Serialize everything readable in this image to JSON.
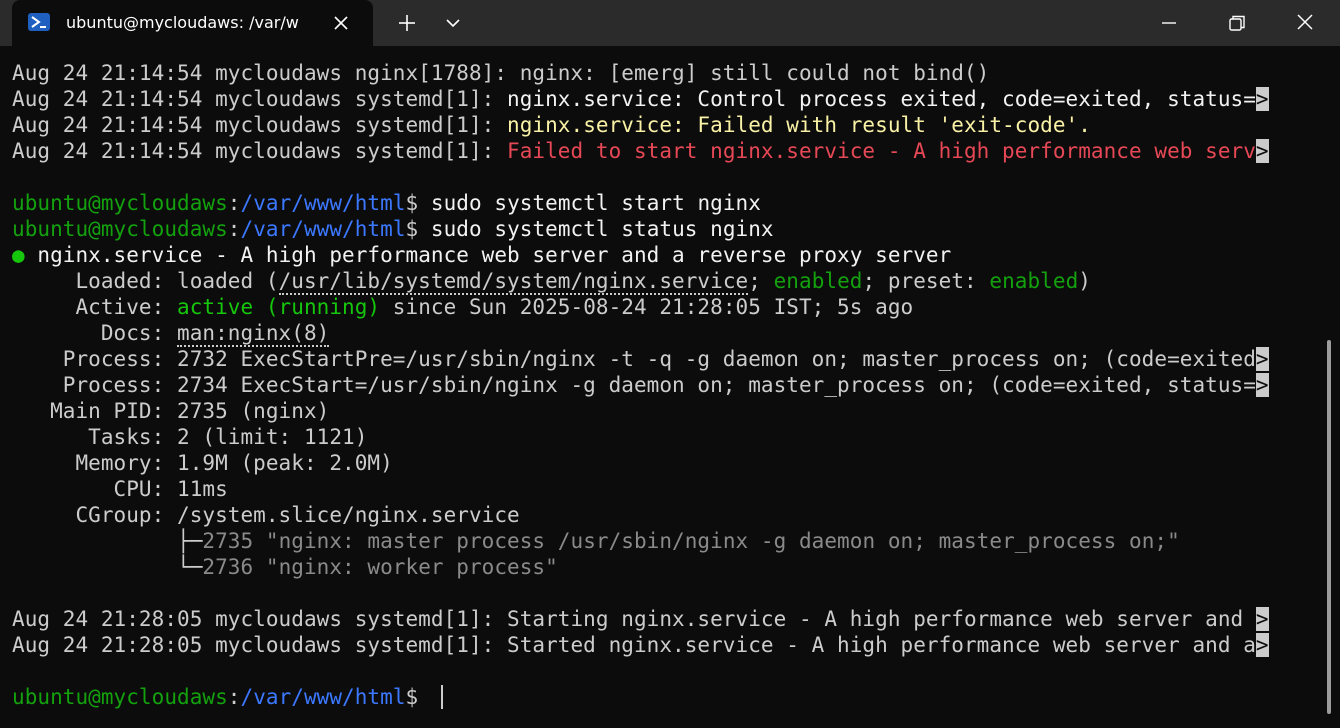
{
  "window": {
    "tab_title": "ubuntu@mycloudaws: /var/w",
    "icons": [
      "terminal-icon",
      "close-icon",
      "plus-icon",
      "chevron-down-icon",
      "minimize-icon",
      "maximize-icon",
      "close-window-icon"
    ]
  },
  "terminal": {
    "colors": {
      "background": "#0c0c0c",
      "text": "#cccccc",
      "green": "#13a10e",
      "blue": "#3b78ff",
      "yellow": "#f9f1a5",
      "red": "#e74856"
    },
    "log1": {
      "l1": "Aug 24 21:14:54 mycloudaws nginx[1788]: nginx: [emerg] still could not bind()",
      "l2_prefix": "Aug 24 21:14:54 mycloudaws systemd[1]: ",
      "l2_msg": "nginx.service: Control process exited, code=exited, status=",
      "l3_prefix": "Aug 24 21:14:54 mycloudaws systemd[1]: ",
      "l3_msg": "nginx.service: Failed with result 'exit-code'.",
      "l4_prefix": "Aug 24 21:14:54 mycloudaws systemd[1]: ",
      "l4_msg": "Failed to start nginx.service - A high performance web serv",
      "trunc": ">"
    },
    "prompt": {
      "user": "ubuntu@mycloudaws",
      "sep": ":",
      "path": "/var/www/html",
      "dollar": "$"
    },
    "cmd1": " sudo systemctl start nginx",
    "cmd2": " sudo systemctl status nginx",
    "status": {
      "bullet": "●",
      "header": " nginx.service - A high performance web server and a reverse proxy server",
      "loaded_label": "     Loaded: ",
      "loaded_a": "loaded (",
      "loaded_path": "/usr/lib/systemd/system/nginx.service",
      "loaded_b": "; ",
      "enabled1": "enabled",
      "loaded_c": "; preset: ",
      "enabled2": "enabled",
      "loaded_d": ")",
      "active_label": "     Active: ",
      "active_state": "active (running)",
      "active_rest": " since Sun 2025-08-24 21:28:05 IST; 5s ago",
      "docs_label": "       Docs: ",
      "docs_value": "man:nginx(8)",
      "proc1": "    Process: 2732 ExecStartPre=/usr/sbin/nginx -t -q -g daemon on; master_process on; (code=exited",
      "proc2": "    Process: 2734 ExecStart=/usr/sbin/nginx -g daemon on; master_process on; (code=exited, status=",
      "mainpid": "   Main PID: 2735 (nginx)",
      "tasks": "      Tasks: 2 (limit: 1121)",
      "memory": "     Memory: 1.9M (peak: 2.0M)",
      "cpu": "        CPU: 11ms",
      "cgroup": "     CGroup: /system.slice/nginx.service",
      "tree1_branch": "             ├─",
      "tree1": "2735 \"nginx: master process /usr/sbin/nginx -g daemon on; master_process on;\"",
      "tree2_branch": "             └─",
      "tree2": "2736 \"nginx: worker process\""
    },
    "log2": {
      "l1": "Aug 24 21:28:05 mycloudaws systemd[1]: Starting nginx.service - A high performance web server and ",
      "l2": "Aug 24 21:28:05 mycloudaws systemd[1]: Started nginx.service - A high performance web server and a",
      "trunc": ">"
    }
  }
}
